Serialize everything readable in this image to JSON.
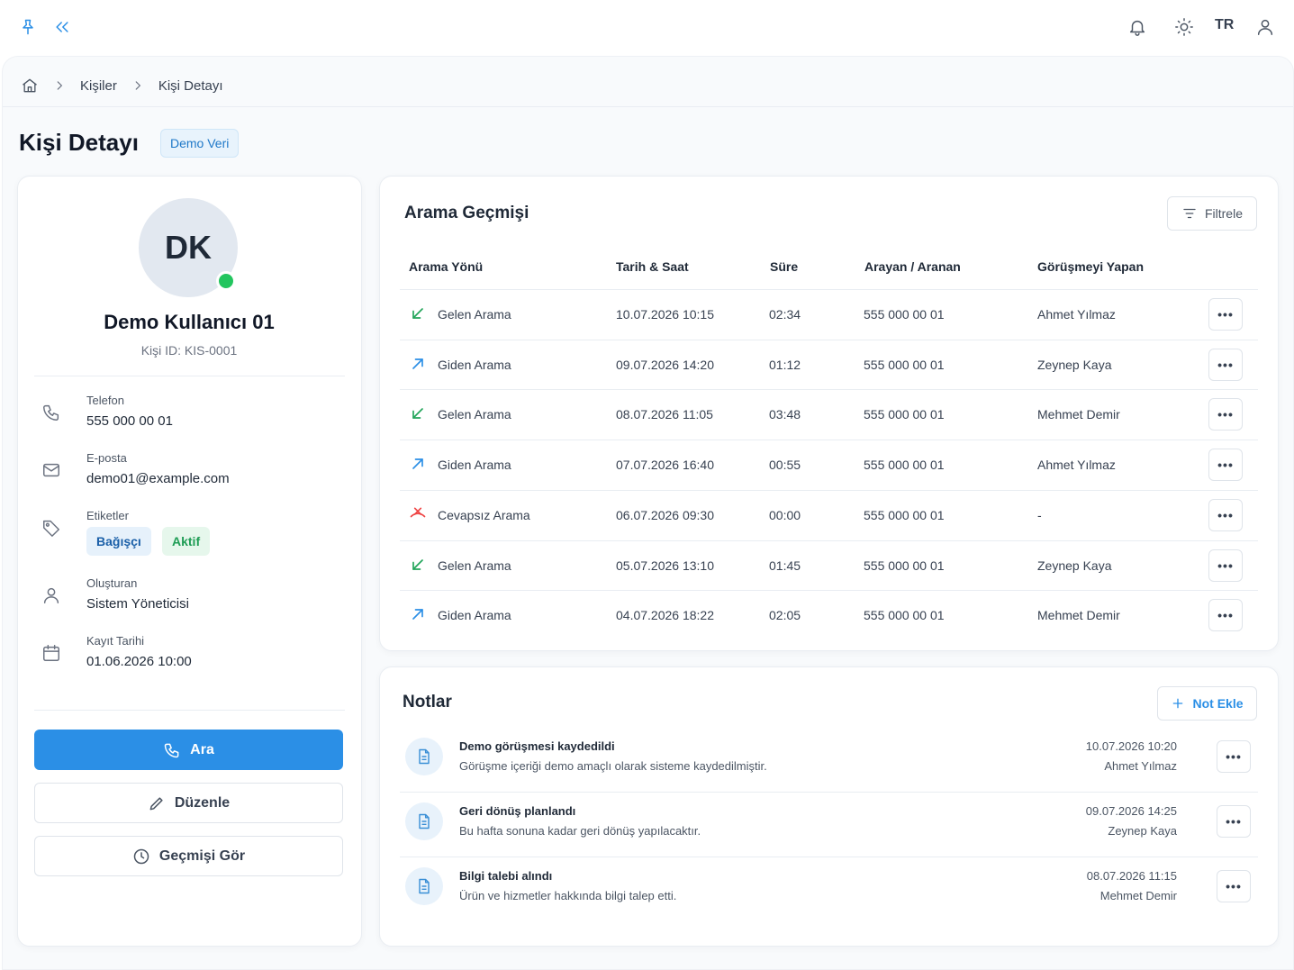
{
  "topbar": {
    "language": "TR"
  },
  "breadcrumb": {
    "items": [
      "Kişiler",
      "Kişi Detayı"
    ]
  },
  "page": {
    "title": "Kişi Detayı",
    "badge": "Demo Veri"
  },
  "profile": {
    "initials": "DK",
    "name": "Demo Kullanıcı 01",
    "person_id": "Kişi ID: KIS-0001",
    "phone_label": "Telefon",
    "phone_value": "555 000 00 01",
    "email_label": "E-posta",
    "email_value": "demo01@example.com",
    "tags_label": "Etiketler",
    "tags": [
      "Bağışçı",
      "Aktif"
    ],
    "creator_label": "Oluşturan",
    "creator_value": "Sistem Yöneticisi",
    "reg_label": "Kayıt Tarihi",
    "reg_value": "01.06.2026 10:00",
    "call_button": "Ara",
    "edit_button": "Düzenle",
    "history_button": "Geçmişi Gör",
    "online_color": "#22c55e"
  },
  "calls": {
    "title": "Arama Geçmişi",
    "filter_button": "Filtrele",
    "columns": [
      "Arama Yönü",
      "Tarih & Saat",
      "Süre",
      "Arayan / Aranan",
      "Görüşmeyi Yapan"
    ],
    "rows": [
      {
        "direction": "Gelen Arama",
        "type": "incoming",
        "datetime": "10.07.2026 10:15",
        "duration": "02:34",
        "number": "555 000 00 01",
        "agent": "Ahmet Yılmaz"
      },
      {
        "direction": "Giden Arama",
        "type": "outgoing",
        "datetime": "09.07.2026 14:20",
        "duration": "01:12",
        "number": "555 000 00 01",
        "agent": "Zeynep Kaya"
      },
      {
        "direction": "Gelen Arama",
        "type": "incoming",
        "datetime": "08.07.2026 11:05",
        "duration": "03:48",
        "number": "555 000 00 01",
        "agent": "Mehmet Demir"
      },
      {
        "direction": "Giden Arama",
        "type": "outgoing",
        "datetime": "07.07.2026 16:40",
        "duration": "00:55",
        "number": "555 000 00 01",
        "agent": "Ahmet Yılmaz"
      },
      {
        "direction": "Cevapsız Arama",
        "type": "missed",
        "datetime": "06.07.2026 09:30",
        "duration": "00:00",
        "number": "555 000 00 01",
        "agent": "-"
      },
      {
        "direction": "Gelen Arama",
        "type": "incoming",
        "datetime": "05.07.2026 13:10",
        "duration": "01:45",
        "number": "555 000 00 01",
        "agent": "Zeynep Kaya"
      },
      {
        "direction": "Giden Arama",
        "type": "outgoing",
        "datetime": "04.07.2026 18:22",
        "duration": "02:05",
        "number": "555 000 00 01",
        "agent": "Mehmet Demir"
      }
    ],
    "colors": {
      "incoming": "#22a55a",
      "outgoing": "#2b8fe6",
      "missed": "#ef4444"
    }
  },
  "notes": {
    "title": "Notlar",
    "add_button": "Not Ekle",
    "items": [
      {
        "title": "Demo görüşmesi kaydedildi",
        "desc": "Görüşme içeriği demo amaçlı olarak sisteme kaydedilmiştir.",
        "date": "10.07.2026 10:20",
        "author": "Ahmet Yılmaz"
      },
      {
        "title": "Geri dönüş planlandı",
        "desc": "Bu hafta sonuna kadar geri dönüş yapılacaktır.",
        "date": "09.07.2026 14:25",
        "author": "Zeynep Kaya"
      },
      {
        "title": "Bilgi talebi alındı",
        "desc": "Ürün ve hizmetler hakkında bilgi talep etti.",
        "date": "08.07.2026 11:15",
        "author": "Mehmet Demir"
      }
    ]
  },
  "accent": "#2b8fe6"
}
